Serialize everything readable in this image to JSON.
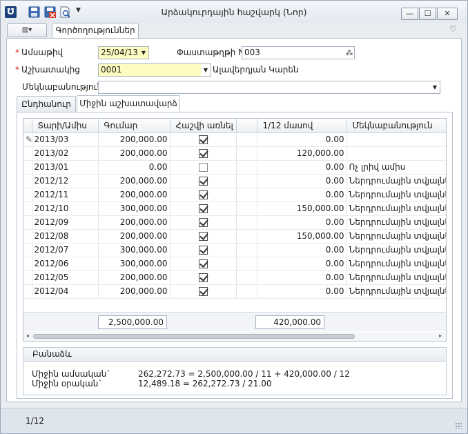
{
  "window": {
    "title": "Արձակուրդային հաշվարկ (Նոր)",
    "min_glyph": "—",
    "max_glyph": "☐",
    "close_glyph": "✕"
  },
  "quick_access": {
    "icons": [
      "save-icon",
      "save-close-icon",
      "print-preview-icon"
    ],
    "more_glyph": "▼"
  },
  "ribbon": {
    "menu_glyph": "▥▾",
    "tab_label": "Գործողություններ",
    "collapse_glyph": "♡"
  },
  "form": {
    "date_label": "Ամսաթիվ",
    "date_value": "25/04/13",
    "doc_no_label": "Փաստաթղթի N",
    "doc_no_value": "003",
    "employee_label": "Աշխատակից",
    "employee_value": "0001",
    "employee_name": "Ալավերդյան Կարեն",
    "comment_label": "Մեկնաբանություն",
    "comment_value": ""
  },
  "tabs": [
    {
      "label": "Ընդհանուր",
      "active": false
    },
    {
      "label": "Միջին աշխատավարձ",
      "active": true
    }
  ],
  "grid": {
    "columns": [
      "Տարի/Ամիս",
      "Գումար",
      "Հաշվի առնել",
      "",
      "1/12 մասով",
      "Մեկնաբանություն"
    ],
    "edit_indicator": "✎",
    "rows": [
      {
        "month": "2013/03",
        "amount": "200,000.00",
        "include": true,
        "twelfth": "0.00",
        "comment": ""
      },
      {
        "month": "2013/02",
        "amount": "200,000.00",
        "include": true,
        "twelfth": "120,000.00",
        "comment": ""
      },
      {
        "month": "2013/01",
        "amount": "0.00",
        "include": false,
        "twelfth": "0.00",
        "comment": "Ոչ լրիվ ամիս"
      },
      {
        "month": "2012/12",
        "amount": "200,000.00",
        "include": true,
        "twelfth": "0.00",
        "comment": "Ներդրումային տվյալներ"
      },
      {
        "month": "2012/11",
        "amount": "200,000.00",
        "include": true,
        "twelfth": "0.00",
        "comment": "Ներդրումային տվյալներ"
      },
      {
        "month": "2012/10",
        "amount": "300,000.00",
        "include": true,
        "twelfth": "150,000.00",
        "comment": "Ներդրումային տվյալներ"
      },
      {
        "month": "2012/09",
        "amount": "200,000.00",
        "include": true,
        "twelfth": "0.00",
        "comment": "Ներդրումային տվյալներ"
      },
      {
        "month": "2012/08",
        "amount": "200,000.00",
        "include": true,
        "twelfth": "150,000.00",
        "comment": "Ներդրումային տվյալներ"
      },
      {
        "month": "2012/07",
        "amount": "300,000.00",
        "include": true,
        "twelfth": "0.00",
        "comment": "Ներդրումային տվյալներ"
      },
      {
        "month": "2012/06",
        "amount": "300,000.00",
        "include": true,
        "twelfth": "0.00",
        "comment": "Ներդրումային տվյալներ"
      },
      {
        "month": "2012/05",
        "amount": "200,000.00",
        "include": true,
        "twelfth": "0.00",
        "comment": "Ներդրումային տվյալներ"
      },
      {
        "month": "2012/04",
        "amount": "200,000.00",
        "include": true,
        "twelfth": "0.00",
        "comment": "Ներդրումային տվյալներ"
      }
    ],
    "total_amount": "2,500,000.00",
    "total_twelfth": "420,000.00"
  },
  "formula": {
    "header": "Բանաձև",
    "monthly_label": "Միջին ամսական`",
    "monthly_value": "262,272.73 = 2,500,000.00 / 11 + 420,000.00 / 12",
    "daily_label": "Միջին օրական`",
    "daily_value": "12,489.18 = 262,272.73 / 21.00"
  },
  "status": {
    "record_position": "1/12"
  }
}
